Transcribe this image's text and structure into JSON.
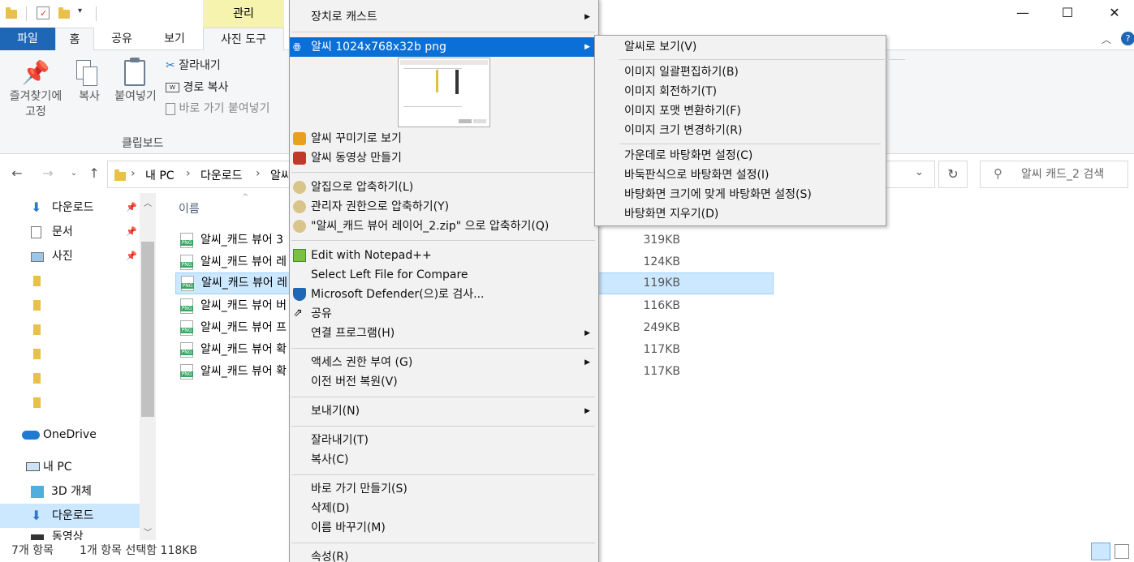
{
  "titlebar": {
    "manage_tab": "관리",
    "minimize": "—",
    "maximize": "☐",
    "close": "✕"
  },
  "ribbon_tabs": [
    "파일",
    "홈",
    "공유",
    "보기",
    "사진 도구"
  ],
  "ribbon": {
    "pin_label_1": "즐겨찾기에",
    "pin_label_2": "고정",
    "copy": "복사",
    "paste": "붙여넣기",
    "cut": "잘라내기",
    "copy_path": "경로 복사",
    "paste_shortcut": "바로 가기 붙여넣기",
    "group_label": "클립보드"
  },
  "address": {
    "segments": [
      "내 PC",
      "다운로드",
      "알씨"
    ],
    "search_placeholder": "알씨 캐드_2 검색"
  },
  "nav": {
    "quick": [
      {
        "label": "다운로드",
        "pinned": true,
        "icon": "download-arrow-icon"
      },
      {
        "label": "문서",
        "pinned": true,
        "icon": "document-icon"
      },
      {
        "label": "사진",
        "pinned": true,
        "icon": "picture-icon"
      }
    ],
    "folders_count": 6,
    "onedrive": "OneDrive",
    "this_pc": "내 PC",
    "objects_3d": "3D 개체",
    "downloads": "다운로드",
    "videos": "동영상"
  },
  "filelist": {
    "column_name": "이름",
    "rows": [
      {
        "name": "알씨_캐드 뷰어 3",
        "size": "319KB",
        "selected": false
      },
      {
        "name": "알씨_캐드 뷰어 레",
        "size": "124KB",
        "selected": false
      },
      {
        "name": "알씨_캐드 뷰어 레",
        "size": "119KB",
        "selected": true
      },
      {
        "name": "알씨_캐드 뷰어 버",
        "size": "116KB",
        "selected": false
      },
      {
        "name": "알씨_캐드 뷰어 프",
        "size": "249KB",
        "selected": false
      },
      {
        "name": "알씨_캐드 뷰어 확",
        "size": "117KB",
        "selected": false
      },
      {
        "name": "알씨_캐드 뷰어 확",
        "size": "117KB",
        "selected": false
      }
    ]
  },
  "status": {
    "count": "7개 항목",
    "selection": "1개 항목 선택함 118KB"
  },
  "context_menu": {
    "cast": "장치로 캐스트",
    "alsee_sub": "알씨 1024x768x32b png",
    "decorate": "알씨 꾸미기로 보기",
    "video": "알씨 동영상 만들기",
    "zip": "알집으로 압축하기(L)",
    "zip_admin": "관리자 권한으로 압축하기(Y)",
    "zip_named": "\"알씨_캐드 뷰어 레이어_2.zip\" 으로 압축하기(Q)",
    "notepad": "Edit with Notepad++",
    "compare": "Select Left File for Compare",
    "defender": "Microsoft Defender(으)로 검사...",
    "share": "공유",
    "open_with": "연결 프로그램(H)",
    "access": "액세스 권한 부여 (G)",
    "restore": "이전 버전 복원(V)",
    "send_to": "보내기(N)",
    "cut": "잘라내기(T)",
    "copy": "복사(C)",
    "shortcut": "바로 가기 만들기(S)",
    "delete": "삭제(D)",
    "rename": "이름 바꾸기(M)",
    "properties": "속성(R)"
  },
  "submenu": {
    "view": "알씨로 보기(V)",
    "batch": "이미지 일괄편집하기(B)",
    "rotate": "이미지 회전하기(T)",
    "convert": "이미지 포맷 변환하기(F)",
    "resize": "이미지 크기 변경하기(R)",
    "wall_center": "가운데로 바탕화면 설정(C)",
    "wall_tile": "바둑판식으로 바탕화면 설정(I)",
    "wall_fit": "바탕화면 크기에 맞게 바탕화면 설정(S)",
    "wall_clear": "바탕화면 지우기(D)"
  },
  "colors": {
    "accent": "#0a6fd6",
    "file_tab": "#1e66b6",
    "manage_tab": "#f6f3ae",
    "selection": "#cce8ff"
  }
}
